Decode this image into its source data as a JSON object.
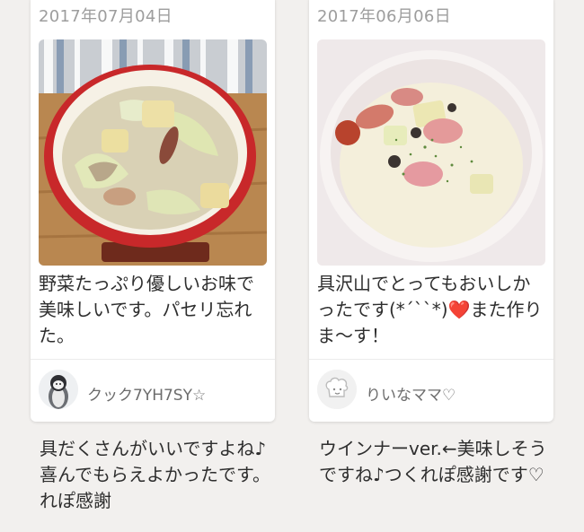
{
  "reports": [
    {
      "date": "2017年07月04日",
      "photo_icon": "soup-bowl-photo",
      "comment": "野菜たっぷり優しいお味で美味しいです。パセリ忘れた。",
      "user": {
        "name": "クック7YH7SY☆",
        "avatar_icon": "penguin-avatar-icon"
      },
      "reply": "具だくさんがいいですよね♪喜んでもらえよかったです。れぽ感謝"
    },
    {
      "date": "2017年06月06日",
      "photo_icon": "cream-soup-photo",
      "comment": "具沢山でとってもおいしかったです(*´``*)❤️また作りま〜す！",
      "user": {
        "name": "りいなママ♡",
        "avatar_icon": "chef-hat-avatar-icon"
      },
      "reply": "ウインナーver.←美味しそうですね♪つくれぽ感謝です♡"
    }
  ]
}
